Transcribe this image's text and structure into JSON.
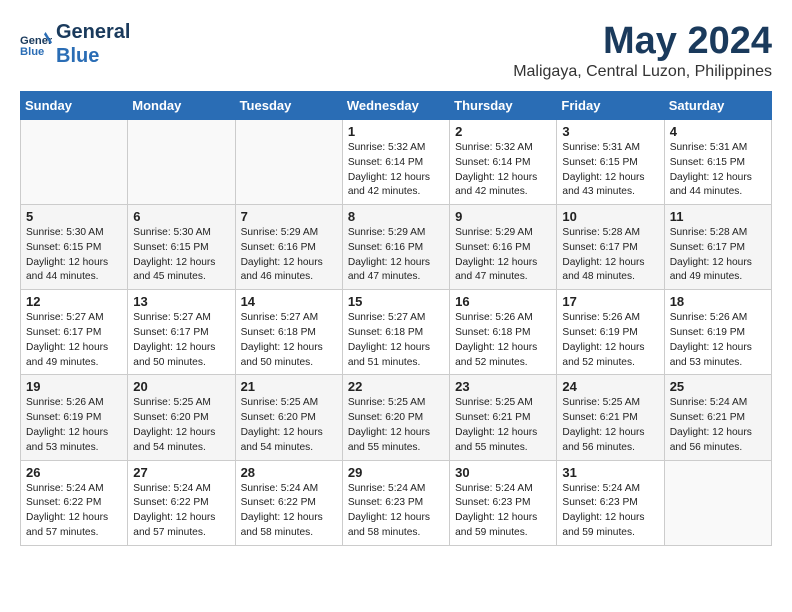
{
  "header": {
    "logo_line1": "General",
    "logo_line2": "Blue",
    "month": "May 2024",
    "location": "Maligaya, Central Luzon, Philippines"
  },
  "days_of_week": [
    "Sunday",
    "Monday",
    "Tuesday",
    "Wednesday",
    "Thursday",
    "Friday",
    "Saturday"
  ],
  "weeks": [
    {
      "days": [
        {
          "num": "",
          "info": ""
        },
        {
          "num": "",
          "info": ""
        },
        {
          "num": "",
          "info": ""
        },
        {
          "num": "1",
          "info": "Sunrise: 5:32 AM\nSunset: 6:14 PM\nDaylight: 12 hours\nand 42 minutes."
        },
        {
          "num": "2",
          "info": "Sunrise: 5:32 AM\nSunset: 6:14 PM\nDaylight: 12 hours\nand 42 minutes."
        },
        {
          "num": "3",
          "info": "Sunrise: 5:31 AM\nSunset: 6:15 PM\nDaylight: 12 hours\nand 43 minutes."
        },
        {
          "num": "4",
          "info": "Sunrise: 5:31 AM\nSunset: 6:15 PM\nDaylight: 12 hours\nand 44 minutes."
        }
      ]
    },
    {
      "days": [
        {
          "num": "5",
          "info": "Sunrise: 5:30 AM\nSunset: 6:15 PM\nDaylight: 12 hours\nand 44 minutes."
        },
        {
          "num": "6",
          "info": "Sunrise: 5:30 AM\nSunset: 6:15 PM\nDaylight: 12 hours\nand 45 minutes."
        },
        {
          "num": "7",
          "info": "Sunrise: 5:29 AM\nSunset: 6:16 PM\nDaylight: 12 hours\nand 46 minutes."
        },
        {
          "num": "8",
          "info": "Sunrise: 5:29 AM\nSunset: 6:16 PM\nDaylight: 12 hours\nand 47 minutes."
        },
        {
          "num": "9",
          "info": "Sunrise: 5:29 AM\nSunset: 6:16 PM\nDaylight: 12 hours\nand 47 minutes."
        },
        {
          "num": "10",
          "info": "Sunrise: 5:28 AM\nSunset: 6:17 PM\nDaylight: 12 hours\nand 48 minutes."
        },
        {
          "num": "11",
          "info": "Sunrise: 5:28 AM\nSunset: 6:17 PM\nDaylight: 12 hours\nand 49 minutes."
        }
      ]
    },
    {
      "days": [
        {
          "num": "12",
          "info": "Sunrise: 5:27 AM\nSunset: 6:17 PM\nDaylight: 12 hours\nand 49 minutes."
        },
        {
          "num": "13",
          "info": "Sunrise: 5:27 AM\nSunset: 6:17 PM\nDaylight: 12 hours\nand 50 minutes."
        },
        {
          "num": "14",
          "info": "Sunrise: 5:27 AM\nSunset: 6:18 PM\nDaylight: 12 hours\nand 50 minutes."
        },
        {
          "num": "15",
          "info": "Sunrise: 5:27 AM\nSunset: 6:18 PM\nDaylight: 12 hours\nand 51 minutes."
        },
        {
          "num": "16",
          "info": "Sunrise: 5:26 AM\nSunset: 6:18 PM\nDaylight: 12 hours\nand 52 minutes."
        },
        {
          "num": "17",
          "info": "Sunrise: 5:26 AM\nSunset: 6:19 PM\nDaylight: 12 hours\nand 52 minutes."
        },
        {
          "num": "18",
          "info": "Sunrise: 5:26 AM\nSunset: 6:19 PM\nDaylight: 12 hours\nand 53 minutes."
        }
      ]
    },
    {
      "days": [
        {
          "num": "19",
          "info": "Sunrise: 5:26 AM\nSunset: 6:19 PM\nDaylight: 12 hours\nand 53 minutes."
        },
        {
          "num": "20",
          "info": "Sunrise: 5:25 AM\nSunset: 6:20 PM\nDaylight: 12 hours\nand 54 minutes."
        },
        {
          "num": "21",
          "info": "Sunrise: 5:25 AM\nSunset: 6:20 PM\nDaylight: 12 hours\nand 54 minutes."
        },
        {
          "num": "22",
          "info": "Sunrise: 5:25 AM\nSunset: 6:20 PM\nDaylight: 12 hours\nand 55 minutes."
        },
        {
          "num": "23",
          "info": "Sunrise: 5:25 AM\nSunset: 6:21 PM\nDaylight: 12 hours\nand 55 minutes."
        },
        {
          "num": "24",
          "info": "Sunrise: 5:25 AM\nSunset: 6:21 PM\nDaylight: 12 hours\nand 56 minutes."
        },
        {
          "num": "25",
          "info": "Sunrise: 5:24 AM\nSunset: 6:21 PM\nDaylight: 12 hours\nand 56 minutes."
        }
      ]
    },
    {
      "days": [
        {
          "num": "26",
          "info": "Sunrise: 5:24 AM\nSunset: 6:22 PM\nDaylight: 12 hours\nand 57 minutes."
        },
        {
          "num": "27",
          "info": "Sunrise: 5:24 AM\nSunset: 6:22 PM\nDaylight: 12 hours\nand 57 minutes."
        },
        {
          "num": "28",
          "info": "Sunrise: 5:24 AM\nSunset: 6:22 PM\nDaylight: 12 hours\nand 58 minutes."
        },
        {
          "num": "29",
          "info": "Sunrise: 5:24 AM\nSunset: 6:23 PM\nDaylight: 12 hours\nand 58 minutes."
        },
        {
          "num": "30",
          "info": "Sunrise: 5:24 AM\nSunset: 6:23 PM\nDaylight: 12 hours\nand 59 minutes."
        },
        {
          "num": "31",
          "info": "Sunrise: 5:24 AM\nSunset: 6:23 PM\nDaylight: 12 hours\nand 59 minutes."
        },
        {
          "num": "",
          "info": ""
        }
      ]
    }
  ]
}
